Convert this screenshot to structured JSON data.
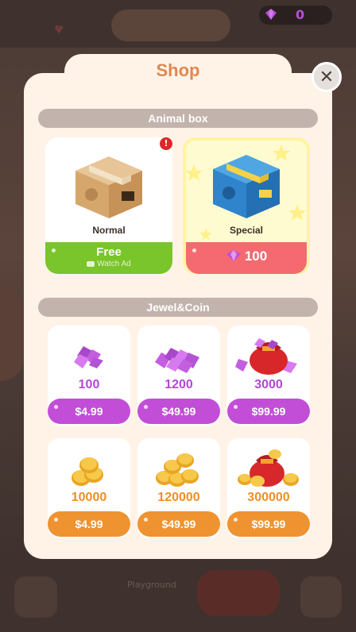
{
  "colors": {
    "accent_orange": "#e0884f",
    "jewel_purple": "#c24ed8",
    "coin_orange": "#ef9331",
    "free_green": "#79c52b",
    "special_red": "#f46a70",
    "section_gray": "#c2b3ad"
  },
  "background": {
    "gem_count": "0",
    "bottom_label": "Playground"
  },
  "shop": {
    "title": "Shop",
    "close_icon": "close-icon",
    "animal_box": {
      "heading": "Animal box",
      "normal": {
        "label": "Normal",
        "button_label": "Free",
        "button_sublabel": "Watch Ad",
        "badge": "!"
      },
      "special": {
        "label": "Special",
        "price": "100"
      }
    },
    "jewel_coin": {
      "heading": "Jewel&Coin",
      "jewels": [
        {
          "amount": "100",
          "price": "$4.99"
        },
        {
          "amount": "1200",
          "price": "$49.99"
        },
        {
          "amount": "3000",
          "price": "$99.99"
        }
      ],
      "coins": [
        {
          "amount": "10000",
          "price": "$4.99"
        },
        {
          "amount": "120000",
          "price": "$49.99"
        },
        {
          "amount": "300000",
          "price": "$99.99"
        }
      ]
    }
  }
}
